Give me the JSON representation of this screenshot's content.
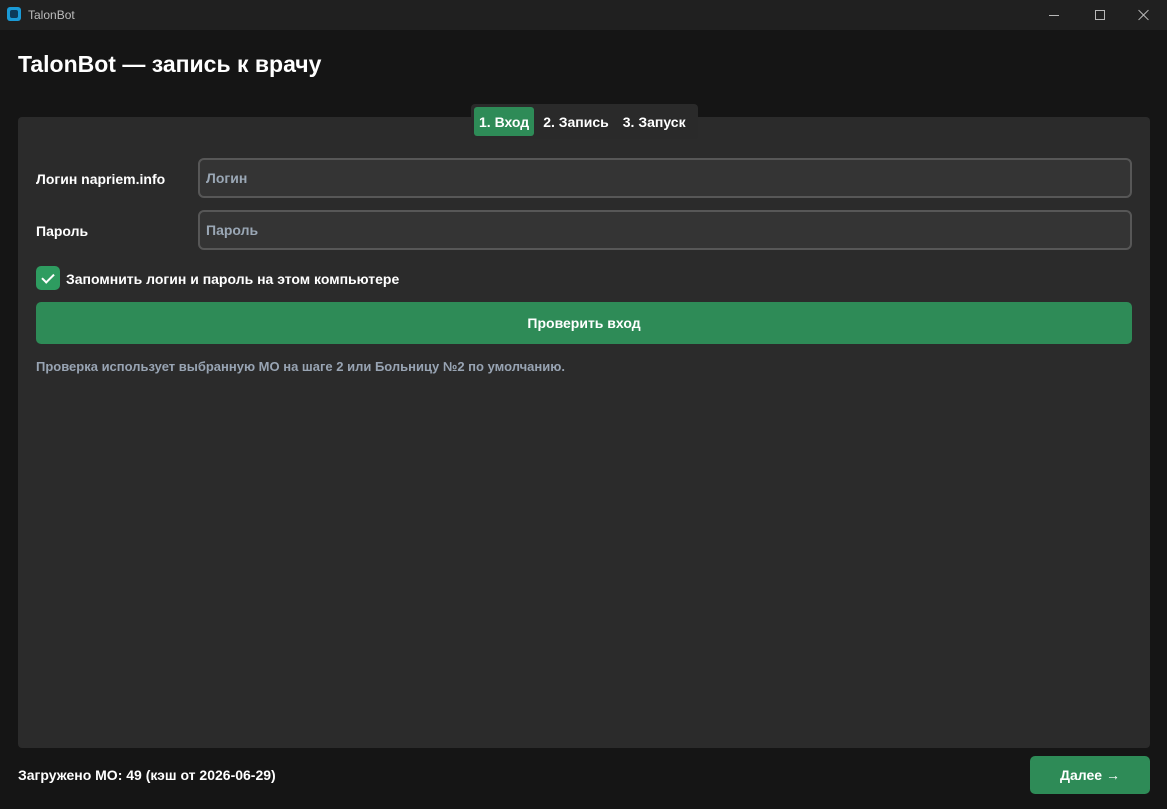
{
  "window": {
    "title": "TalonBot",
    "app_icon": "talonbot-app-icon",
    "controls": [
      "minimize-icon",
      "maximize-icon",
      "close-icon"
    ]
  },
  "header": {
    "title": "TalonBot — запись к врачу"
  },
  "tabs": [
    {
      "label": "1. Вход",
      "active": true
    },
    {
      "label": "2. Запись",
      "active": false
    },
    {
      "label": "3. Запуск",
      "active": false
    }
  ],
  "login_form": {
    "login_label": "Логин napriem.info",
    "login_placeholder": "Логин",
    "login_value": "",
    "password_label": "Пароль",
    "password_placeholder": "Пароль",
    "password_value": "",
    "remember_label": "Запомнить логин и пароль на этом компьютере",
    "remember_checked": true,
    "verify_button_label": "Проверить вход",
    "hint": "Проверка использует выбранную МО на шаге 2 или Больницу №2 по умолчанию."
  },
  "footer": {
    "status": "Загружено МО: 49 (кэш от 2026-06-29)",
    "next_button_label": "Далее →"
  },
  "colors": {
    "accent": "#2e8b57",
    "background": "#151515",
    "panel": "#2b2b2b",
    "hint_text": "#98a4b3"
  }
}
